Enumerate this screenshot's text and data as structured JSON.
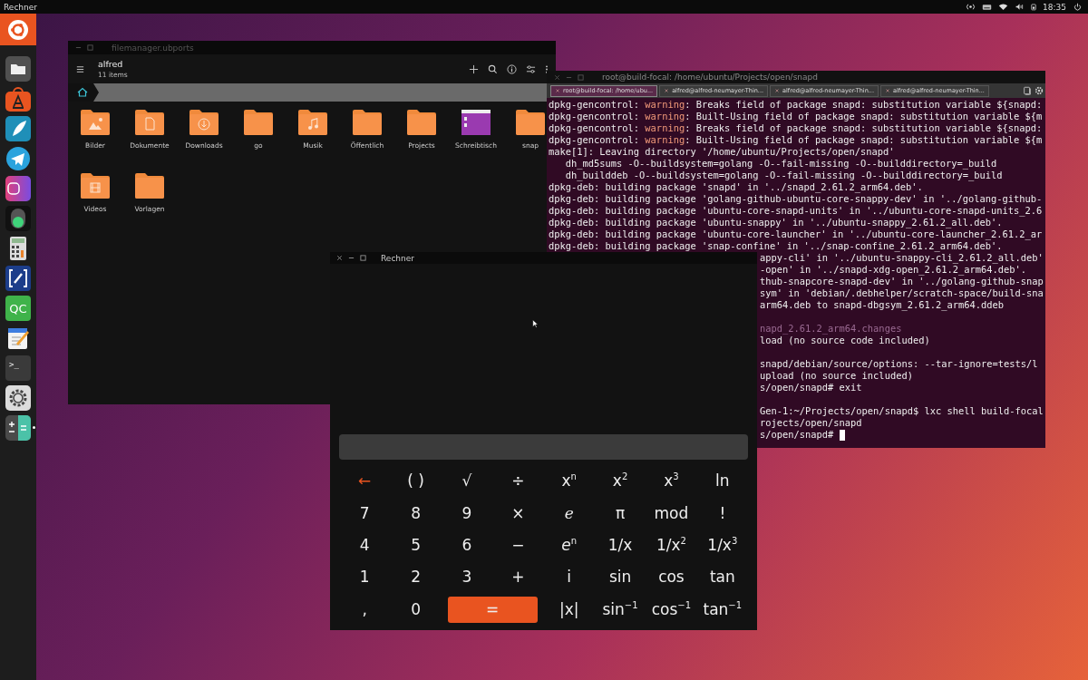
{
  "top_bar": {
    "app_name": "Rechner",
    "clock": "18:35"
  },
  "dock": {
    "items": [
      {
        "kind": "ubuntu"
      },
      {
        "kind": "files"
      },
      {
        "kind": "store"
      },
      {
        "kind": "feather"
      },
      {
        "kind": "telegram"
      },
      {
        "kind": "camera"
      },
      {
        "kind": "light"
      },
      {
        "kind": "calculator"
      },
      {
        "kind": "pen"
      },
      {
        "kind": "glyph",
        "glyph": "QC"
      },
      {
        "kind": "editor"
      },
      {
        "kind": "terminal",
        "glyph": ">_"
      },
      {
        "kind": "settings"
      },
      {
        "kind": "calc",
        "running": true
      }
    ]
  },
  "file_manager": {
    "title": "filemanager.ubports",
    "folder": "alfred",
    "count": "11 items",
    "items": [
      {
        "name": "Bilder",
        "kind": "pictures"
      },
      {
        "name": "Dokumente",
        "kind": "documents"
      },
      {
        "name": "Downloads",
        "kind": "downloads"
      },
      {
        "name": "go",
        "kind": "plain"
      },
      {
        "name": "Musik",
        "kind": "music"
      },
      {
        "name": "Öffentlich",
        "kind": "plain"
      },
      {
        "name": "Projects",
        "kind": "plain"
      },
      {
        "name": "Schreibtisch",
        "kind": "desktop"
      },
      {
        "name": "snap",
        "kind": "plain"
      },
      {
        "name": "Videos",
        "kind": "videos"
      },
      {
        "name": "Vorlagen",
        "kind": "plain"
      }
    ]
  },
  "terminal": {
    "title": "root@build-focal: /home/ubuntu/Projects/open/snapd",
    "tabs": [
      {
        "label": "root@build-focal: /home/ubu...",
        "selected": true
      },
      {
        "label": "alfred@alfred-neumayer-Thin...",
        "selected": false
      },
      {
        "label": "alfred@alfred-neumayer-Thin...",
        "selected": false
      },
      {
        "label": "alfred@alfred-neumayer-Thin...",
        "selected": false
      }
    ],
    "lines": [
      {
        "text": "dpkg-gencontrol: ",
        "highlight": "warning",
        "rest": ": Breaks field of package snapd: substitution variable ${snapd:"
      },
      {
        "text": "dpkg-gencontrol: ",
        "highlight": "warning",
        "rest": ": Built-Using field of package snapd: substitution variable ${m"
      },
      {
        "text": "dpkg-gencontrol: ",
        "highlight": "warning",
        "rest": ": Breaks field of package snapd: substitution variable ${snapd:"
      },
      {
        "text": "dpkg-gencontrol: ",
        "highlight": "warning",
        "rest": ": Built-Using field of package snapd: substitution variable ${m"
      },
      {
        "text": "make[1]: Leaving directory '/home/ubuntu/Projects/open/snapd'"
      },
      {
        "text": "   dh_md5sums -O--buildsystem=golang -O--fail-missing -O--builddirectory=_build"
      },
      {
        "text": "   dh_builddeb -O--buildsystem=golang -O--fail-missing -O--builddirectory=_build"
      },
      {
        "text": "dpkg-deb: building package 'snapd' in '../snapd_2.61.2_arm64.deb'."
      },
      {
        "text": "dpkg-deb: building package 'golang-github-ubuntu-core-snappy-dev' in '../golang-github-"
      },
      {
        "text": "dpkg-deb: building package 'ubuntu-core-snapd-units' in '../ubuntu-core-snapd-units_2.6"
      },
      {
        "text": "dpkg-deb: building package 'ubuntu-snappy' in '../ubuntu-snappy_2.61.2_all.deb'."
      },
      {
        "text": "dpkg-deb: building package 'ubuntu-core-launcher' in '../ubuntu-core-launcher_2.61.2_ar"
      },
      {
        "text": "dpkg-deb: building package 'snap-confine' in '../snap-confine_2.61.2_arm64.deb'."
      }
    ],
    "covered_lines": [
      {
        "text": "appy-cli' in '../ubuntu-snappy-cli_2.61.2_all.deb'"
      },
      {
        "text": "-open' in '../snapd-xdg-open_2.61.2_arm64.deb'."
      },
      {
        "text": "thub-snapcore-snapd-dev' in '../golang-github-snap"
      },
      {
        "text": "sym' in 'debian/.debhelper/scratch-space/build-sna"
      },
      {
        "text": "arm64.deb to snapd-dbgsym_2.61.2_arm64.ddeb"
      },
      {
        "text": "napd_2.61.2_arm64.changes",
        "gap_before": true,
        "dim": true
      },
      {
        "text": "load (no source code included)"
      },
      {
        "text": "snapd/debian/source/options: --tar-ignore=tests/l",
        "gap_before": true
      },
      {
        "text": "upload (no source included)"
      },
      {
        "text": "s/open/snapd# exit"
      },
      {
        "text": "Gen-1:~/Projects/open/snapd$ lxc shell build-focal",
        "gap_before": true
      },
      {
        "text": "rojects/open/snapd"
      },
      {
        "text": "s/open/snapd# ",
        "cursor": true
      }
    ]
  },
  "calculator": {
    "title": "Rechner",
    "keys": [
      {
        "label": "←",
        "kind": "delete"
      },
      {
        "label": "( )",
        "kind": "key"
      },
      {
        "label": "√",
        "kind": "key"
      },
      {
        "label": "÷",
        "kind": "key"
      },
      {
        "label": "x$^{n}$",
        "kind": "key"
      },
      {
        "label": "x$^{2}$",
        "kind": "key"
      },
      {
        "label": "x$^{3}$",
        "kind": "key"
      },
      {
        "label": "ln",
        "kind": "key"
      },
      {
        "label": "7",
        "kind": "key"
      },
      {
        "label": "8",
        "kind": "key"
      },
      {
        "label": "9",
        "kind": "key"
      },
      {
        "label": "×",
        "kind": "key"
      },
      {
        "label": "e",
        "kind": "constant"
      },
      {
        "label": "π",
        "kind": "key"
      },
      {
        "label": "mod",
        "kind": "key"
      },
      {
        "label": "!",
        "kind": "key"
      },
      {
        "label": "4",
        "kind": "key"
      },
      {
        "label": "5",
        "kind": "key"
      },
      {
        "label": "6",
        "kind": "key"
      },
      {
        "label": "−",
        "kind": "key"
      },
      {
        "label": "*e*$^{n}$",
        "kind": "key"
      },
      {
        "label": "1/x",
        "kind": "key"
      },
      {
        "label": "1/x$^{2}$",
        "kind": "key"
      },
      {
        "label": "1/x$^{3}$",
        "kind": "key"
      },
      {
        "label": "1",
        "kind": "key"
      },
      {
        "label": "2",
        "kind": "key"
      },
      {
        "label": "3",
        "kind": "key"
      },
      {
        "label": "+",
        "kind": "key"
      },
      {
        "label": "i",
        "kind": "key"
      },
      {
        "label": "sin",
        "kind": "key"
      },
      {
        "label": "cos",
        "kind": "key"
      },
      {
        "label": "tan",
        "kind": "key"
      },
      {
        "label": ",",
        "kind": "key"
      },
      {
        "label": "0",
        "kind": "key"
      },
      {
        "label": "=",
        "kind": "equals"
      },
      {
        "label": "|x|",
        "kind": "key"
      },
      {
        "label": "sin$^{−1}$",
        "kind": "key"
      },
      {
        "label": "cos$^{−1}$",
        "kind": "key"
      },
      {
        "label": "tan$^{−1}$",
        "kind": "key"
      }
    ]
  }
}
